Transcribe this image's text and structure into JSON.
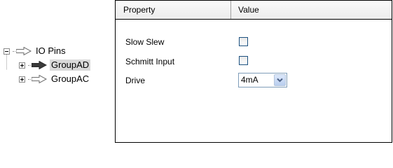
{
  "tree": {
    "root": {
      "label": "IO Pins",
      "expanded": true
    },
    "children": [
      {
        "label": "GroupAD",
        "selected": true,
        "expanded": false
      },
      {
        "label": "GroupAC",
        "selected": false,
        "expanded": false
      }
    ]
  },
  "grid": {
    "columns": {
      "property": "Property",
      "value": "Value"
    },
    "rows": [
      {
        "label": "Slow Slew",
        "type": "checkbox",
        "checked": false
      },
      {
        "label": "Schmitt Input",
        "type": "checkbox",
        "checked": false
      },
      {
        "label": "Drive",
        "type": "select",
        "value": "4mA"
      }
    ]
  },
  "colors": {
    "selection_bg": "#d9d9d9",
    "checkbox_border": "#1c5180",
    "select_border": "#7f9db9"
  }
}
